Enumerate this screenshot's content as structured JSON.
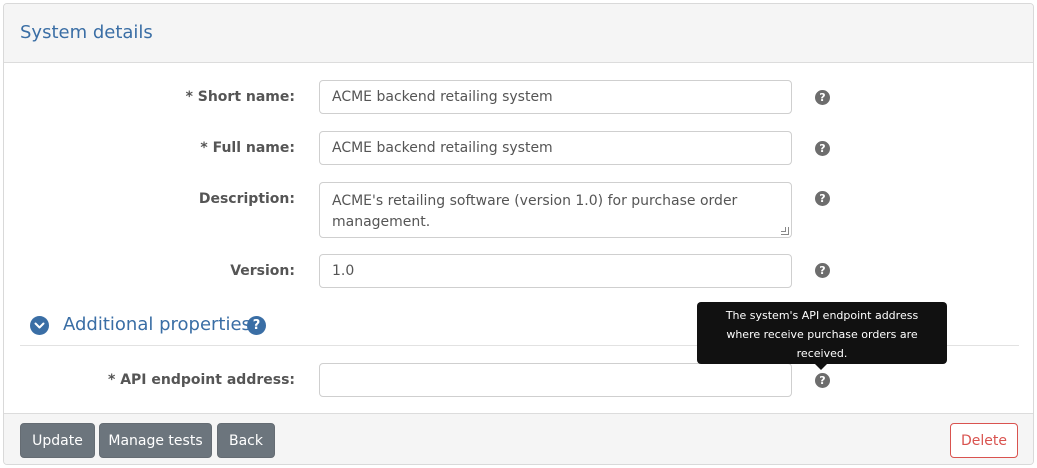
{
  "panel": {
    "title": "System details"
  },
  "fields": {
    "short_name": {
      "label": "* Short name:",
      "value": "ACME backend retailing system"
    },
    "full_name": {
      "label": "* Full name:",
      "value": "ACME backend retailing system"
    },
    "description": {
      "label": "Description:",
      "value": "ACME's retailing software (version 1.0) for purchase order management."
    },
    "version": {
      "label": "Version:",
      "value": "1.0"
    },
    "api_endpoint": {
      "label": "* API endpoint address:",
      "value": ""
    }
  },
  "help_glyph": "?",
  "additional": {
    "title": "Additional properties"
  },
  "tooltip": {
    "line1": "The system's API endpoint address",
    "line2": "where receive purchase orders are",
    "line3": "received."
  },
  "footer": {
    "update_label": "Update",
    "manage_tests_label": "Manage tests",
    "back_label": "Back",
    "delete_label": "Delete"
  },
  "colors": {
    "accent": "#3a6ea5",
    "danger": "#d9534f",
    "secondary": "#6c757d"
  },
  "icons": {
    "toggle": "chevron-down-icon",
    "help": "question-circle-icon"
  }
}
